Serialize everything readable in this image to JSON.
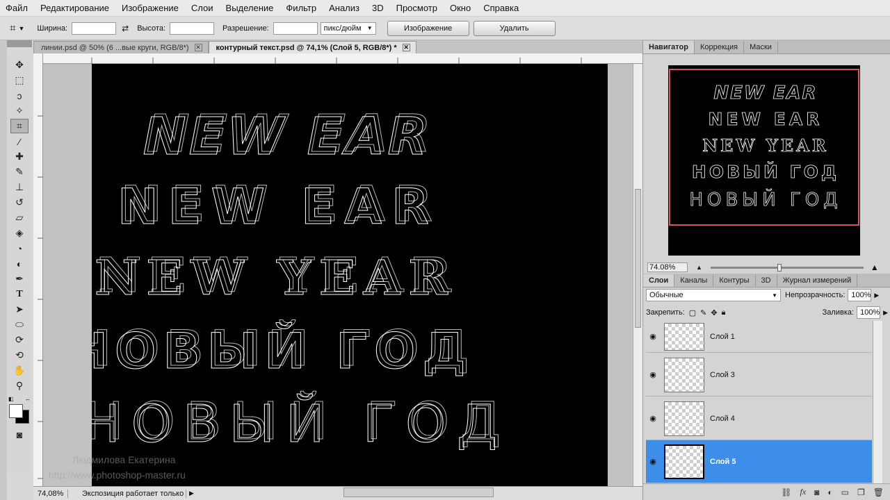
{
  "menu": [
    "Файл",
    "Редактирование",
    "Изображение",
    "Слои",
    "Выделение",
    "Фильтр",
    "Анализ",
    "3D",
    "Просмотр",
    "Окно",
    "Справка"
  ],
  "options": {
    "width_label": "Ширина:",
    "height_label": "Высота:",
    "resolution_label": "Разрешение:",
    "units_value": "пикс/дюйм",
    "image_button": "Изображение",
    "delete_button": "Удалить"
  },
  "tabs": [
    {
      "label": "линии.psd @ 50% (6 ...вые круги, RGB/8*)"
    },
    {
      "label": "контурный текст.psd @ 74,1% (Слой 5, RGB/8*) *"
    }
  ],
  "canvas": {
    "lines": [
      "NEW EAR",
      "NEW EAR",
      "NEW YEAR",
      "НОВЫЙ ГОД",
      "НОВЫЙ ГОД"
    ]
  },
  "watermark": {
    "name": "Людмилова Екатерина",
    "url": "http://www.photoshop-master.ru"
  },
  "status": {
    "zoom": "74,08%",
    "info": "Экспозиция работает только в ..."
  },
  "navigator": {
    "tabs": [
      "Навигатор",
      "Коррекция",
      "Маски"
    ],
    "zoom": "74.08%",
    "zoom_fraction": 0.74,
    "preview_lines": [
      "NEW EAR",
      "NEW EAR",
      "NEW YEAR",
      "НОВЫЙ ГОД",
      "НОВЫЙ ГОД"
    ]
  },
  "layers_panel": {
    "tabs": [
      "Слои",
      "Каналы",
      "Контуры",
      "3D",
      "Журнал измерений"
    ],
    "blend_mode": "Обычные",
    "opacity_label": "Непрозрачность:",
    "opacity_value": "100%",
    "lock_label": "Закрепить:",
    "fill_label": "Заливка:",
    "fill_value": "100%",
    "layers": [
      {
        "name": "Слой 1"
      },
      {
        "name": "Слой 3"
      },
      {
        "name": "Слой 4"
      },
      {
        "name": "Слой 5"
      }
    ]
  },
  "colors": {
    "selected_layer": "#3d8ee8",
    "nav_frame": "#e0505a"
  }
}
